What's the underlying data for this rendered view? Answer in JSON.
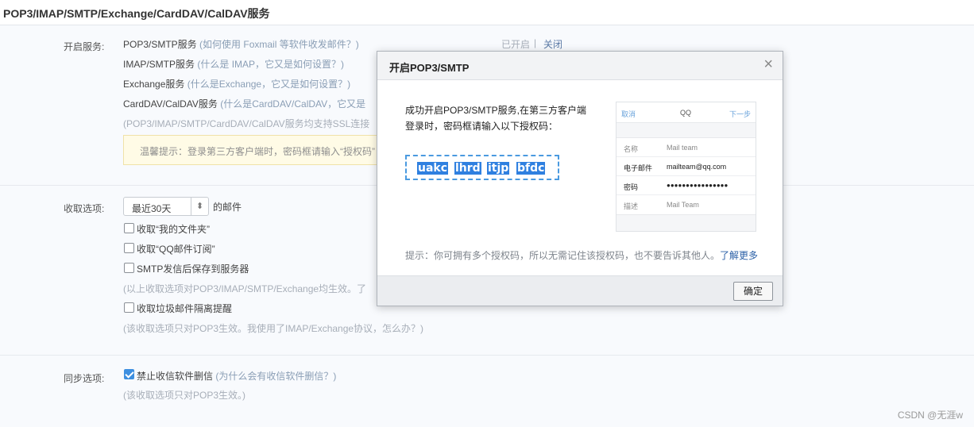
{
  "header": {
    "title": "POP3/IMAP/SMTP/Exchange/CardDAV/CalDAV服务"
  },
  "services": {
    "label": "开启服务:",
    "rows": [
      {
        "name": "POP3/SMTP服务",
        "help": "(如何使用 Foxmail 等软件收发邮件？)"
      },
      {
        "name": "IMAP/SMTP服务",
        "help": "(什么是 IMAP，它又是如何设置？)"
      },
      {
        "name": "Exchange服务",
        "help": "(什么是Exchange，它又是如何设置？)"
      },
      {
        "name": "CardDAV/CalDAV服务",
        "help": "(什么是CardDAV/CalDAV，它又是"
      }
    ],
    "ssl_note": "(POP3/IMAP/SMTP/CardDAV/CalDAV服务均支持SSL连接",
    "status_on": "已开启",
    "status_sep": "|",
    "status_off": "关闭",
    "notice": "温馨提示：登录第三方客户端时，密码框请输入“授权码”"
  },
  "receive": {
    "label": "收取选项:",
    "select_value": "最近30天",
    "select_suffix": "的邮件",
    "options": [
      {
        "label": "收取“我的文件夹”",
        "checked": false
      },
      {
        "label": "收取“QQ邮件订阅”",
        "checked": false
      },
      {
        "label": "SMTP发信后保存到服务器",
        "checked": false
      }
    ],
    "note1": "(以上收取选项对POP3/IMAP/SMTP/Exchange均生效。了",
    "spam_option": {
      "label": "收取垃圾邮件隔离提醒",
      "checked": false
    },
    "note2": "(该收取选项只对POP3生效。我使用了IMAP/Exchange协议，怎么办？)"
  },
  "sync": {
    "label": "同步选项:",
    "option": {
      "label": "禁止收信软件删信",
      "checked": true
    },
    "option_help": "(为什么会有收信软件删信？)",
    "note": "(该收取选项只对POP3生效。)"
  },
  "watermark": "CSDN @无涯w",
  "modal": {
    "title": "开启POP3/SMTP",
    "close": "×",
    "text_line1": "成功开启POP3/SMTP服务,在第三方客户端",
    "text_line2": "登录时，密码框请输入以下授权码：",
    "code_parts": [
      "uakc",
      "lhrd",
      "itjp",
      "bfdc"
    ],
    "phone": {
      "cancel": "取消",
      "title": "QQ",
      "next": "下一步",
      "rows": [
        {
          "key": "名称",
          "value": "Mail team"
        },
        {
          "key": "电子邮件",
          "value": "mailteam@qq.com"
        },
        {
          "key": "密码",
          "value": "●●●●●●●●●●●●●●●●"
        },
        {
          "key": "描述",
          "value": "Mail Team"
        }
      ]
    },
    "hint": "提示：你可拥有多个授权码，所以无需记住该授权码，也不要告诉其他人。",
    "hint_link": "了解更多",
    "ok": "确定"
  }
}
